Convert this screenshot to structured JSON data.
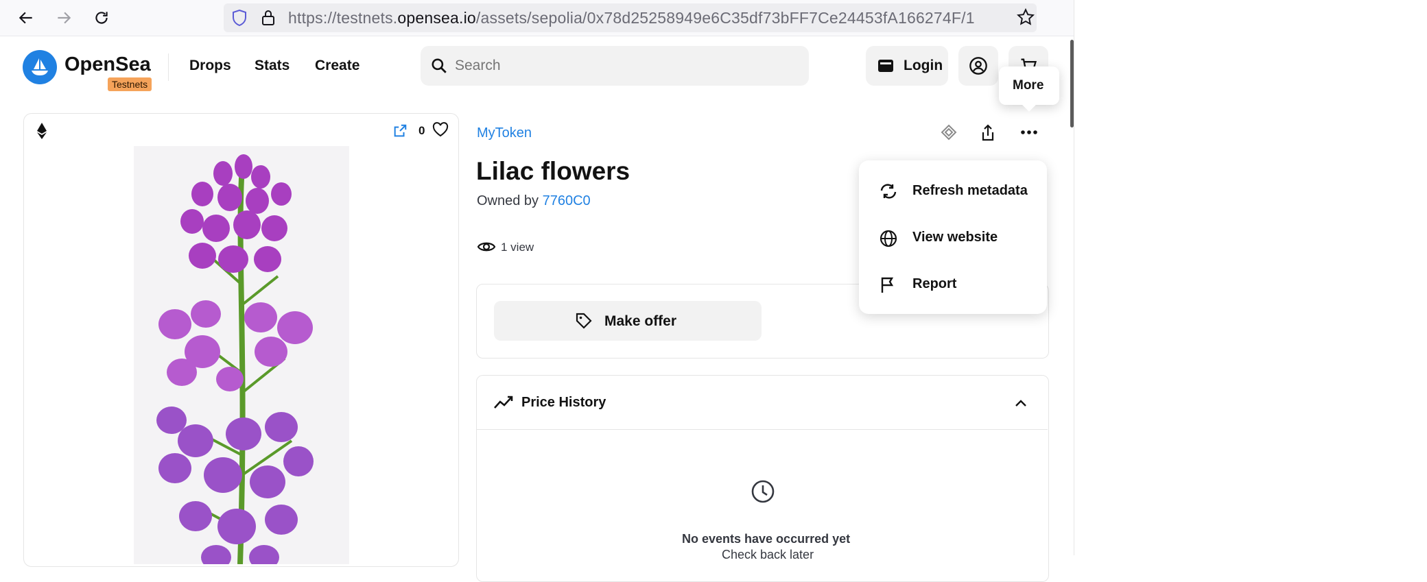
{
  "browser": {
    "url_prefix": "https://testnets.",
    "url_domain": "opensea.io",
    "url_path": "/assets/sepolia/0x78d25258949e6C35df73bFF7Ce24453fA166274F/1"
  },
  "header": {
    "logo_text": "OpenSea",
    "badge": "Testnets",
    "nav": [
      "Drops",
      "Stats",
      "Create"
    ],
    "search_placeholder": "Search",
    "login_label": "Login",
    "tooltip": "More"
  },
  "media": {
    "favorites_count": "0"
  },
  "asset": {
    "collection": "MyToken",
    "title": "Lilac flowers",
    "owned_by_label": "Owned by",
    "owner": "7760C0",
    "views": "1 view"
  },
  "offer": {
    "label": "Make offer"
  },
  "price_history": {
    "label": "Price History",
    "empty_title": "No events have occurred yet",
    "empty_sub": "Check back later"
  },
  "menu": {
    "items": [
      {
        "label": "Refresh metadata",
        "icon": "refresh-icon"
      },
      {
        "label": "View website",
        "icon": "globe-icon"
      },
      {
        "label": "Report",
        "icon": "flag-icon"
      }
    ]
  },
  "colors": {
    "brand": "#2081e2",
    "badge": "#f5a35a",
    "flower": "#a83fc0"
  }
}
